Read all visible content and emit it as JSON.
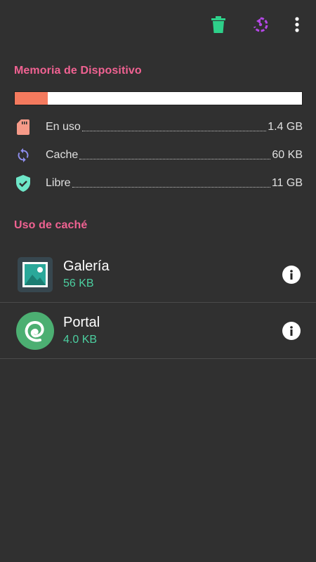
{
  "toolbar": {
    "icons": [
      "trash-icon",
      "refresh-icon",
      "more-vert-icon"
    ],
    "trash_color": "#2ed08a",
    "refresh_color": "#b447e6"
  },
  "memory": {
    "title": "Memoria de Dispositivo",
    "used_fraction": 0.116,
    "bar_fill_color": "#f47a5e",
    "rows": [
      {
        "icon": "sd-card-icon",
        "label": "En uso",
        "value": "1.4 GB",
        "color": "#f69a88"
      },
      {
        "icon": "sync-icon",
        "label": "Cache",
        "value": "60 KB",
        "color": "#8f8ff0"
      },
      {
        "icon": "shield-check-icon",
        "label": "Libre",
        "value": "11 GB",
        "color": "#6ee6c8"
      }
    ]
  },
  "cache": {
    "title": "Uso de caché",
    "apps": [
      {
        "icon": "gallery-app-icon",
        "name": "Galería",
        "size": "56 KB"
      },
      {
        "icon": "portal-app-icon",
        "name": "Portal",
        "size": "4.0 KB"
      }
    ]
  },
  "colors": {
    "accent": "#f06292",
    "size_text": "#4ccfa0",
    "background": "#303030"
  }
}
